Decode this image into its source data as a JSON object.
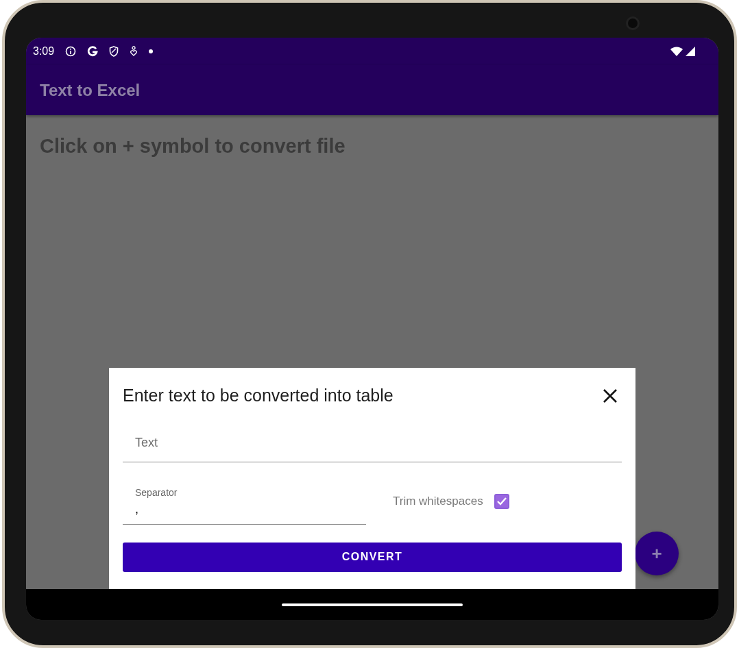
{
  "status_bar": {
    "time": "3:09"
  },
  "app_bar": {
    "title": "Text to Excel"
  },
  "content": {
    "hint": "Click on + symbol to convert file"
  },
  "fab": {
    "label": "+"
  },
  "dialog": {
    "title": "Enter text to be converted into table",
    "text_field": {
      "placeholder": "Text"
    },
    "separator_field": {
      "label": "Separator",
      "value": ","
    },
    "trim_whitespaces": {
      "label": "Trim whitespaces",
      "checked": true
    },
    "button": "CONVERT"
  }
}
